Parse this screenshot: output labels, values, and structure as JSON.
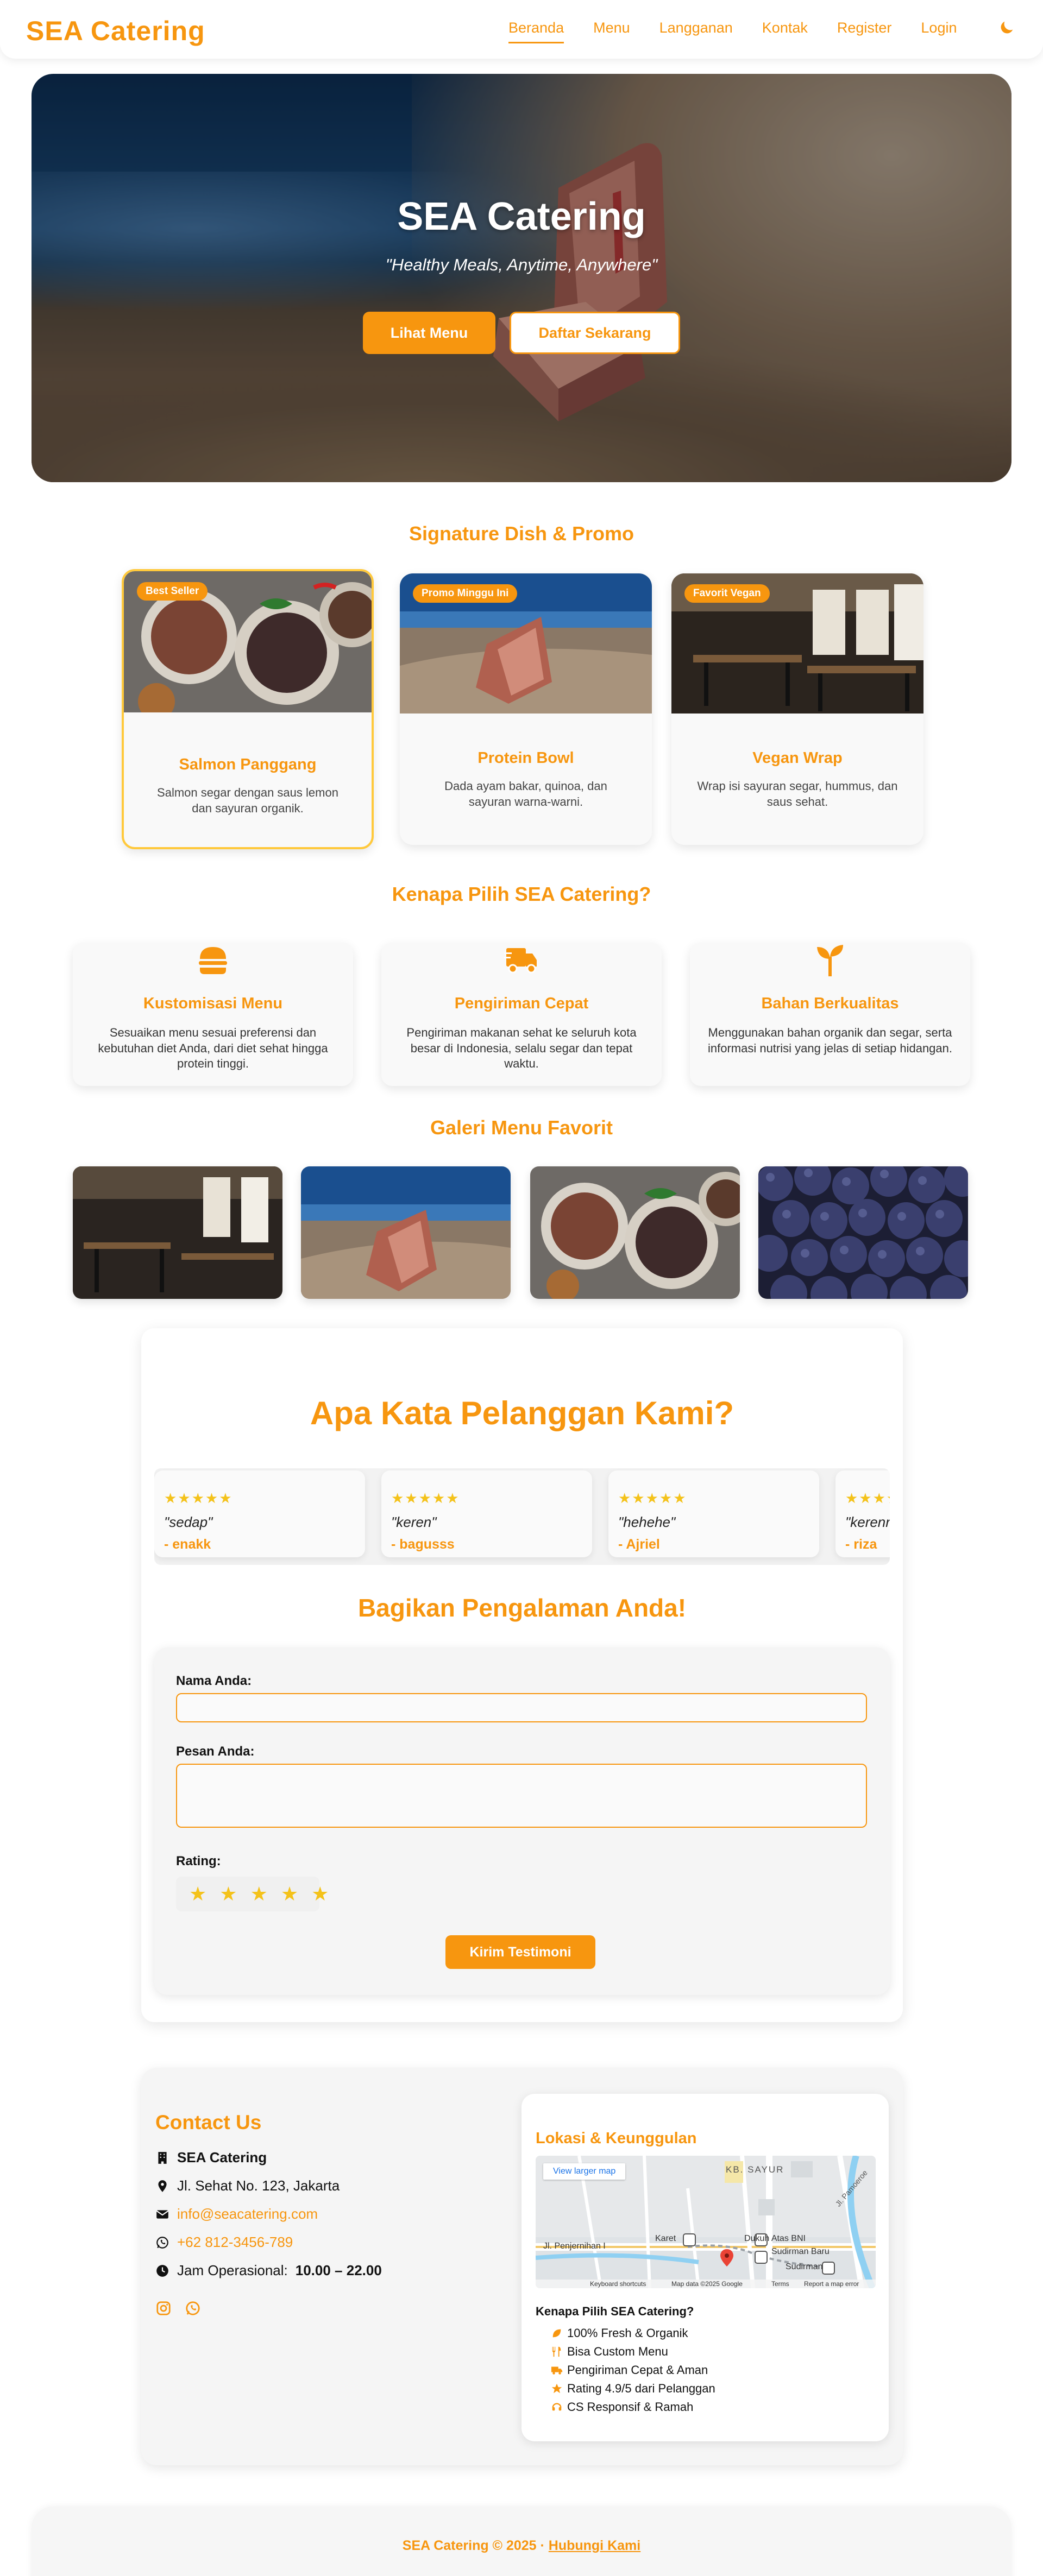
{
  "nav": {
    "brand": "SEA Catering",
    "links": [
      "Beranda",
      "Menu",
      "Langganan",
      "Kontak",
      "Register",
      "Login"
    ]
  },
  "hero": {
    "title": "SEA Catering",
    "subtitle": "\"Healthy Meals, Anytime, Anywhere\"",
    "primary_btn": "Lihat Menu",
    "secondary_btn": "Daftar Sekarang"
  },
  "signature": {
    "title": "Signature Dish & Promo",
    "cards": [
      {
        "badge": "Best Seller",
        "name": "Salmon Panggang",
        "desc": "Salmon segar dengan saus lemon dan sayuran organik."
      },
      {
        "badge": "Promo Minggu Ini",
        "name": "Protein Bowl",
        "desc": "Dada ayam bakar, quinoa, dan sayuran warna-warni."
      },
      {
        "badge": "Favorit Vegan",
        "name": "Vegan Wrap",
        "desc": "Wrap isi sayuran segar, hummus, dan saus sehat."
      }
    ]
  },
  "why": {
    "title": "Kenapa Pilih SEA Catering?",
    "features": [
      {
        "icon": "burger-icon",
        "title": "Kustomisasi Menu",
        "desc": "Sesuaikan menu sesuai preferensi dan kebutuhan diet Anda, dari diet sehat hingga protein tinggi."
      },
      {
        "icon": "delivery-truck-icon",
        "title": "Pengiriman Cepat",
        "desc": "Pengiriman makanan sehat ke seluruh kota besar di Indonesia, selalu segar dan tepat waktu."
      },
      {
        "icon": "seedling-icon",
        "title": "Bahan Berkualitas",
        "desc": "Menggunakan bahan organik dan segar, serta informasi nutrisi yang jelas di setiap hidangan."
      }
    ]
  },
  "gallery": {
    "title": "Galeri Menu Favorit"
  },
  "testimonials": {
    "title": "Apa Kata Pelanggan Kami?",
    "items": [
      {
        "stars": "★★★★★",
        "quote": "\"sedap\"",
        "author": "- enakk"
      },
      {
        "stars": "★★★★★",
        "quote": "\"keren\"",
        "author": "- bagusss"
      },
      {
        "stars": "★★★★★",
        "quote": "\"hehehe\"",
        "author": "- Ajriel"
      },
      {
        "stars": "★★★★★",
        "quote": "\"kerenn\"",
        "author": "- riza"
      }
    ],
    "share_title": "Bagikan Pengalaman Anda!",
    "form": {
      "name_label": "Nama Anda:",
      "message_label": "Pesan Anda:",
      "rating_label": "Rating:",
      "rating_stars": [
        "★",
        "★",
        "★",
        "★",
        "★"
      ],
      "submit": "Kirim Testimoni"
    }
  },
  "contact": {
    "title": "Contact Us",
    "company": "SEA Catering",
    "address": "Jl. Sehat No. 123, Jakarta",
    "email": "info@seacatering.com",
    "phone": "+62 812-3456-789",
    "hours_label": "Jam Operasional:",
    "hours": "10.00 – 22.00",
    "location": {
      "title": "Lokasi & Keunggulan",
      "map_link": "View larger map",
      "map_labels": {
        "area": "KB. SAYUR",
        "street1": "Jl. Penjernihan I",
        "station1": "Karet",
        "station2": "Dukuh Atas BNI",
        "station3": "Sudirman Baru",
        "station4": "Sudirman",
        "road": "Jl. Pamoeroe",
        "footer1": "Keyboard shortcuts",
        "footer2": "Map data ©2025 Google",
        "footer3": "Terms",
        "footer4": "Report a map error"
      },
      "why_title": "Kenapa Pilih SEA Catering?",
      "why_items": [
        "100% Fresh & Organik",
        "Bisa Custom Menu",
        "Pengiriman Cepat & Aman",
        "Rating 4.9/5 dari Pelanggan",
        "CS Responsif & Ramah"
      ]
    }
  },
  "footer": {
    "text": "SEA Catering © 2025 · ",
    "link": "Hubungi Kami"
  },
  "colors": {
    "accent": "#f7960f",
    "star": "#f4c21a"
  }
}
